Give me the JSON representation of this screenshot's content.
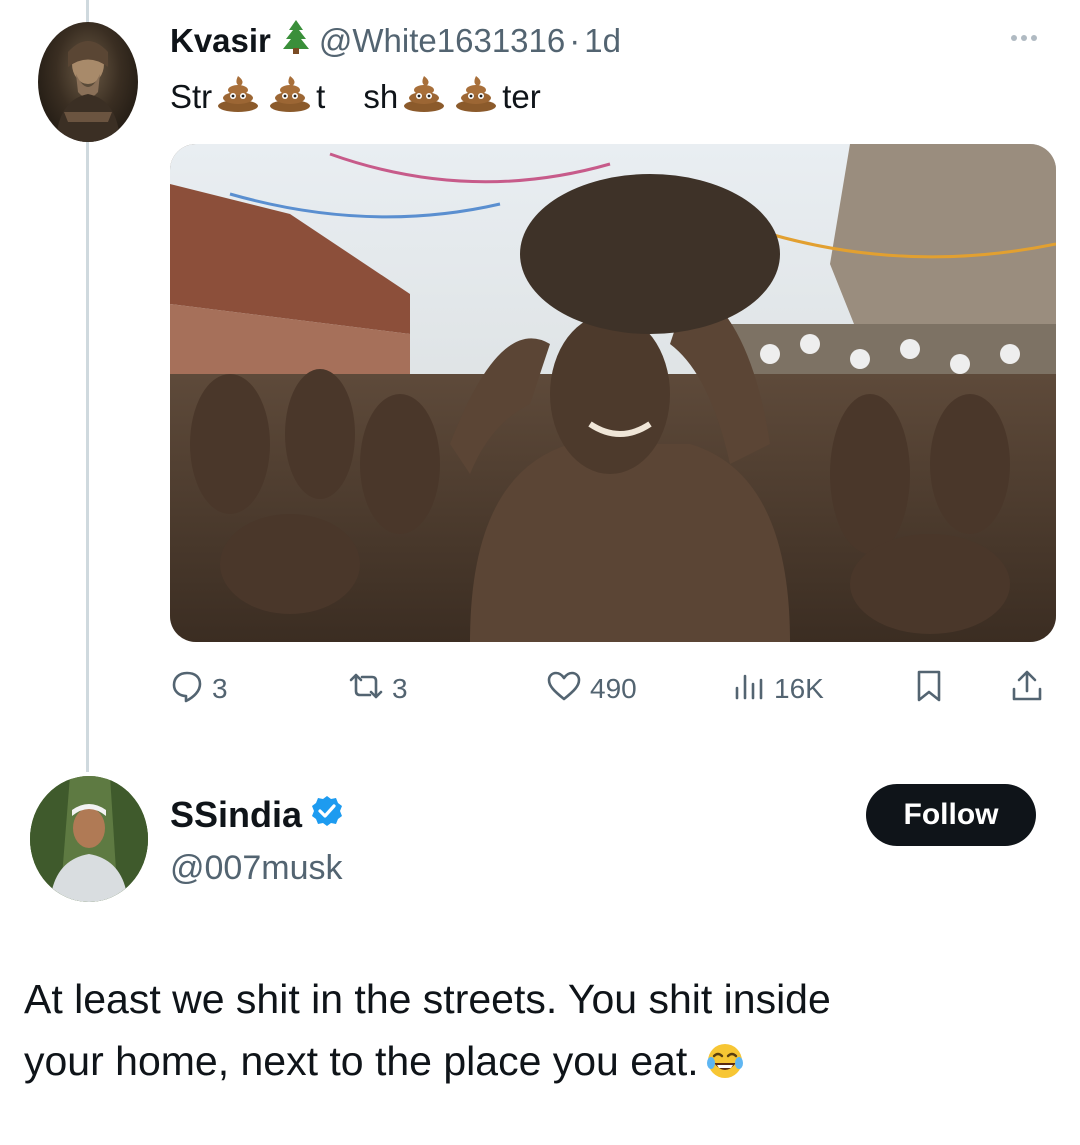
{
  "tweet1": {
    "author_name": "Kvasir",
    "name_emoji_icon": "evergreen-tree-icon",
    "handle": "@White1631316",
    "separator": "·",
    "time": "1d",
    "text_segments": [
      "Str",
      "t",
      "sh",
      "ter"
    ],
    "inline_emoji_icon": "pile-of-poo-icon",
    "image_description_icon": "photo",
    "stats": {
      "replies": "3",
      "reposts": "3",
      "likes": "490",
      "views": "16K"
    }
  },
  "tweet2": {
    "author_name": "SSindia",
    "verified": true,
    "handle": "@007musk",
    "follow_label": "Follow",
    "text_line1": "At least we shit in the streets. You shit inside",
    "text_line2": "your home, next to the place you eat.",
    "trailing_emoji_icon": "face-with-tears-of-joy-icon"
  },
  "colors": {
    "text": "#0f1419",
    "secondary_text": "#536471",
    "thread_line": "#cfd9de",
    "verified_blue": "#1d9bf0",
    "follow_button": "#0f1419"
  }
}
